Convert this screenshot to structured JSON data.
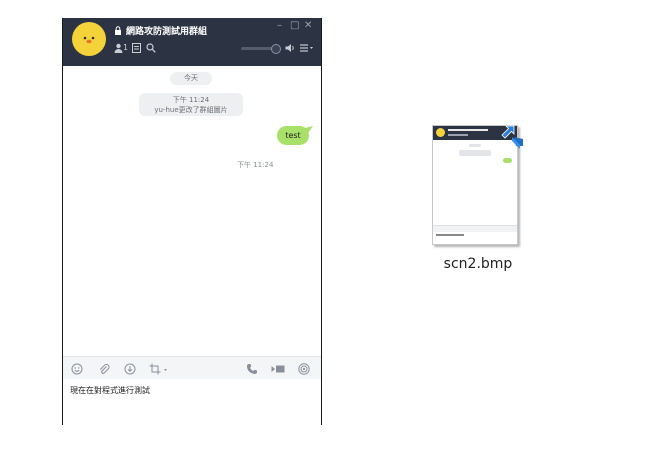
{
  "chat_window": {
    "title": "網路攻防測試用群組",
    "member_count": "1",
    "window_controls": {
      "minimize": "–",
      "maximize": "□",
      "close": "✕"
    },
    "date_separator": "今天",
    "system_message": {
      "time": "下午 11:24",
      "text": "yu-hue更改了群組圖片"
    },
    "messages": [
      {
        "text": "test",
        "time": "下午 11:24",
        "sender": "self"
      }
    ],
    "input_text": "現在在對程式進行測試",
    "icons": {
      "header": [
        "lock-icon",
        "member-icon",
        "album-icon",
        "search-icon",
        "speaker-icon",
        "menu-icon"
      ],
      "toolbar": [
        "emoji-icon",
        "attach-icon",
        "download-icon",
        "crop-icon",
        "phone-icon",
        "video-icon",
        "broadcast-icon"
      ]
    },
    "colors": {
      "header_bg": "#2c3343",
      "avatar": "#f3d23a",
      "bubble": "#a8e06a",
      "pill_bg": "#eeeff1"
    }
  },
  "desktop_file": {
    "name": "scn2.bmp",
    "icon": "shortcut-arrow-icon"
  }
}
